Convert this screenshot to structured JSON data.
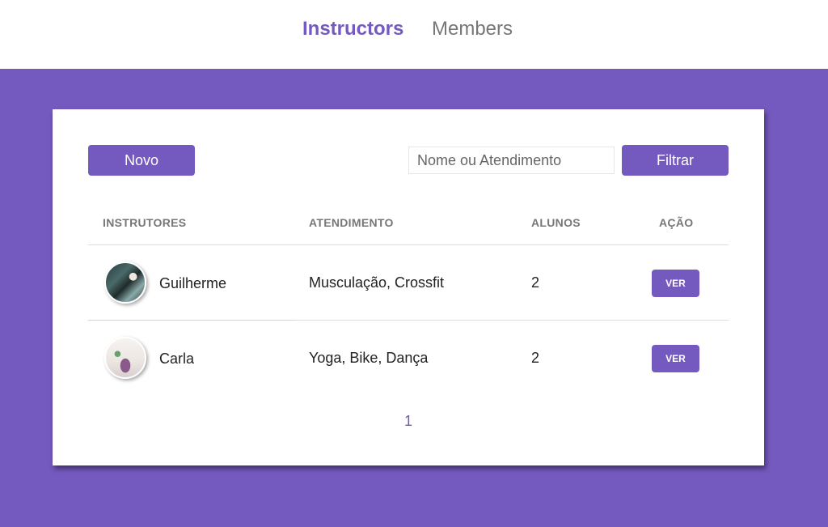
{
  "nav": {
    "instructors": "Instructors",
    "members": "Members"
  },
  "toolbar": {
    "new_label": "Novo",
    "search_placeholder": "Nome ou Atendimento",
    "search_value": "",
    "filter_label": "Filtrar"
  },
  "table": {
    "headers": [
      "INSTRUTORES",
      "ATENDIMENTO",
      "ALUNOS",
      "AÇÃO"
    ],
    "rows": [
      {
        "name": "Guilherme",
        "services": "Musculação, Crossfit",
        "students": "2",
        "action": "VER"
      },
      {
        "name": "Carla",
        "services": "Yoga, Bike, Dança",
        "students": "2",
        "action": "VER"
      }
    ]
  },
  "pagination": {
    "pages": [
      "1"
    ]
  },
  "colors": {
    "primary": "#7459bf",
    "background": "#7459bf",
    "card": "#ffffff"
  }
}
